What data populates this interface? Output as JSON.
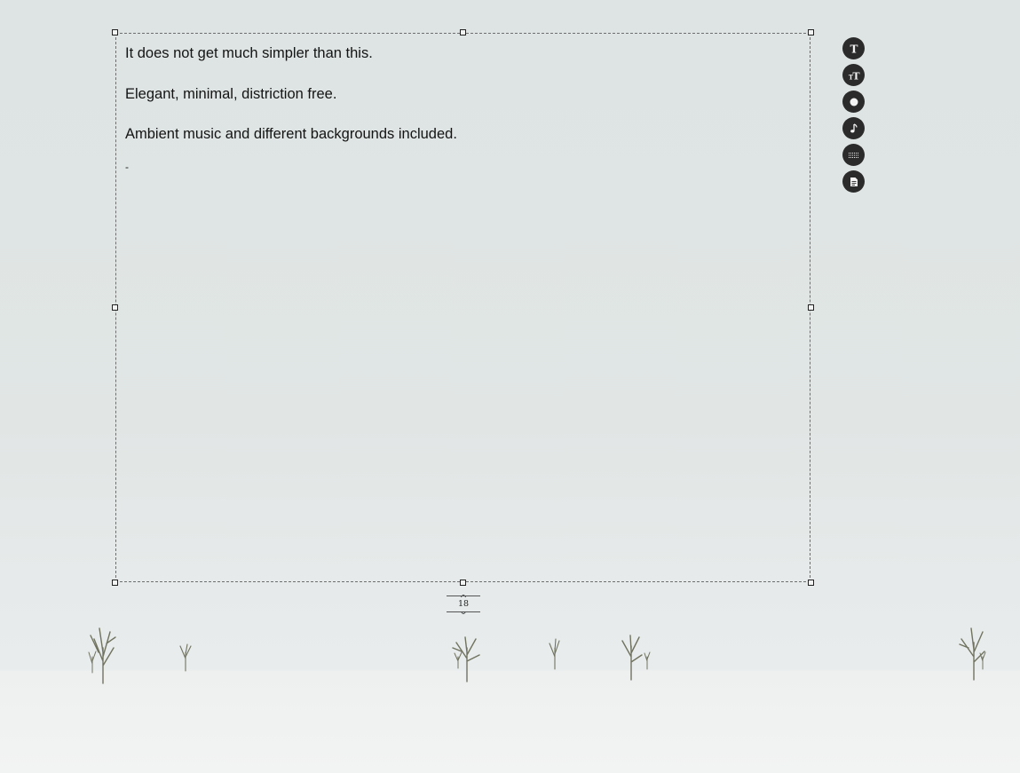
{
  "editor": {
    "lines": [
      "It does not get much simpler than this.",
      "Elegant, minimal, distriction free.",
      "Ambient music and different backgrounds included."
    ],
    "caret": "-"
  },
  "font_size": {
    "value": "18"
  },
  "toolbar": {
    "items": [
      {
        "icon": "font-family-icon",
        "glyph": "T"
      },
      {
        "icon": "font-size-icon",
        "glyph": "TT"
      },
      {
        "icon": "theme-circle-icon",
        "glyph": "●"
      },
      {
        "icon": "music-note-icon",
        "glyph": "♪"
      },
      {
        "icon": "background-grid-icon",
        "glyph": "grid"
      },
      {
        "icon": "document-icon",
        "glyph": "doc"
      }
    ]
  },
  "colors": {
    "background": "#dfe5e4",
    "ground": "#f0f2f2",
    "toolbar_button": "#2b2b2b",
    "text": "#141414"
  }
}
